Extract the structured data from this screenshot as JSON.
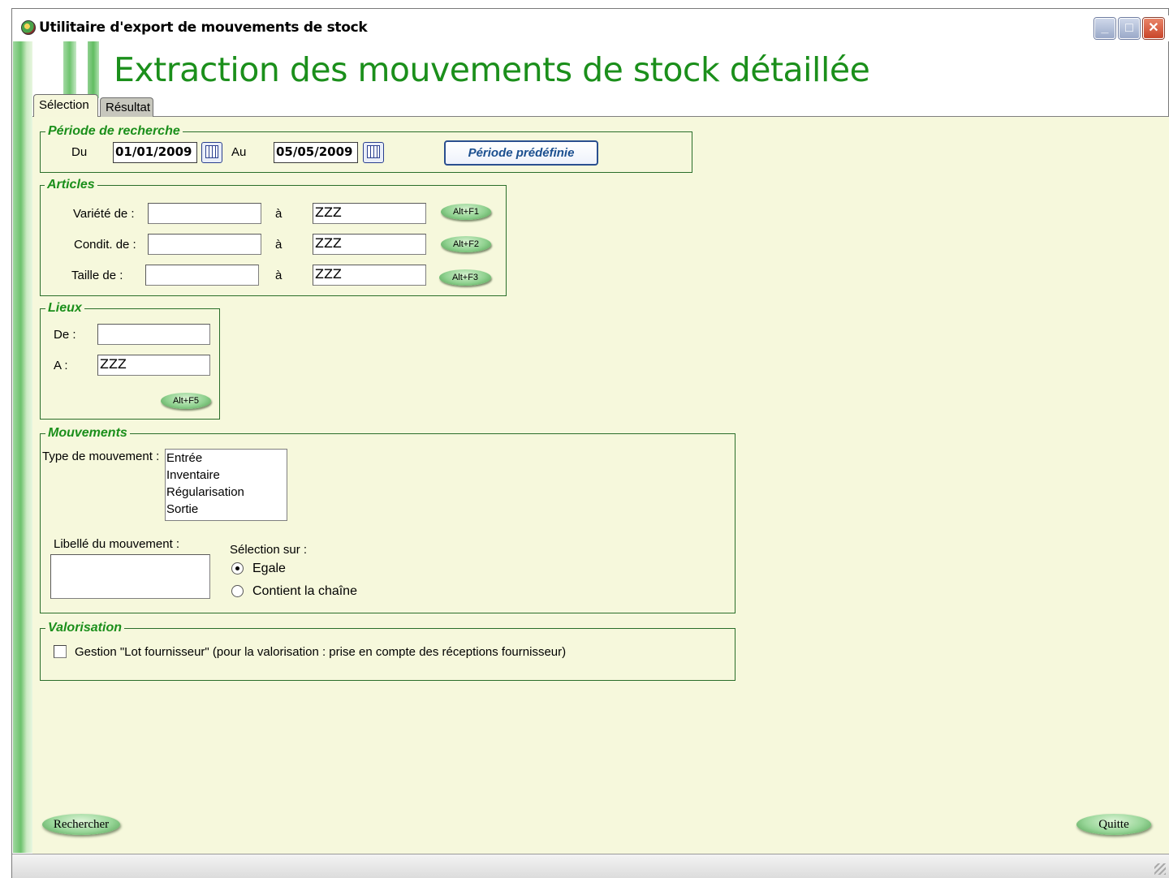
{
  "window": {
    "title": "Utilitaire d'export de mouvements de stock",
    "minimize": "_",
    "maximize": "□",
    "close": "✕"
  },
  "page_title": "Extraction des mouvements de stock détaillée",
  "tabs": [
    {
      "label": "Sélection",
      "active": true
    },
    {
      "label": "Résultat",
      "active": false
    }
  ],
  "periode": {
    "legend": "Période de recherche",
    "du_label": "Du",
    "du_value": "01/01/2009",
    "au_label": "Au",
    "au_value": "05/05/2009",
    "predefined_button": "Période prédéfinie"
  },
  "articles": {
    "legend": "Articles",
    "rows": [
      {
        "label": "Variété de :",
        "from": "",
        "sep": "à",
        "to": "ZZZ",
        "shortcut": "Alt+F1"
      },
      {
        "label": "Condit. de :",
        "from": "",
        "sep": "à",
        "to": "ZZZ",
        "shortcut": "Alt+F2"
      },
      {
        "label": "Taille de :",
        "from": "",
        "sep": "à",
        "to": "ZZZ",
        "shortcut": "Alt+F3"
      }
    ]
  },
  "lieux": {
    "legend": "Lieux",
    "de_label": "De :",
    "de_value": "",
    "a_label": "A :",
    "a_value": "ZZZ",
    "shortcut": "Alt+F5"
  },
  "mouvements": {
    "legend": "Mouvements",
    "type_label": "Type de mouvement :",
    "types": [
      "Entrée",
      "Inventaire",
      "Régularisation",
      "Sortie"
    ],
    "libelle_label": "Libellé du mouvement :",
    "libelle_value": "",
    "selection_label": "Sélection sur :",
    "options": [
      {
        "label": "Egale",
        "selected": true
      },
      {
        "label": "Contient la chaîne",
        "selected": false
      }
    ]
  },
  "valorisation": {
    "legend": "Valorisation",
    "checkbox_label": "Gestion \"Lot fournisseur\" (pour la valorisation : prise en compte des réceptions fournisseur)",
    "checked": false
  },
  "footer": {
    "search_button": "Rechercher",
    "quit_button": "Quitte"
  },
  "colors": {
    "title_green": "#1b8f1b",
    "panel_bg": "#f6f8dc",
    "frame_green": "#2a6e2a"
  }
}
